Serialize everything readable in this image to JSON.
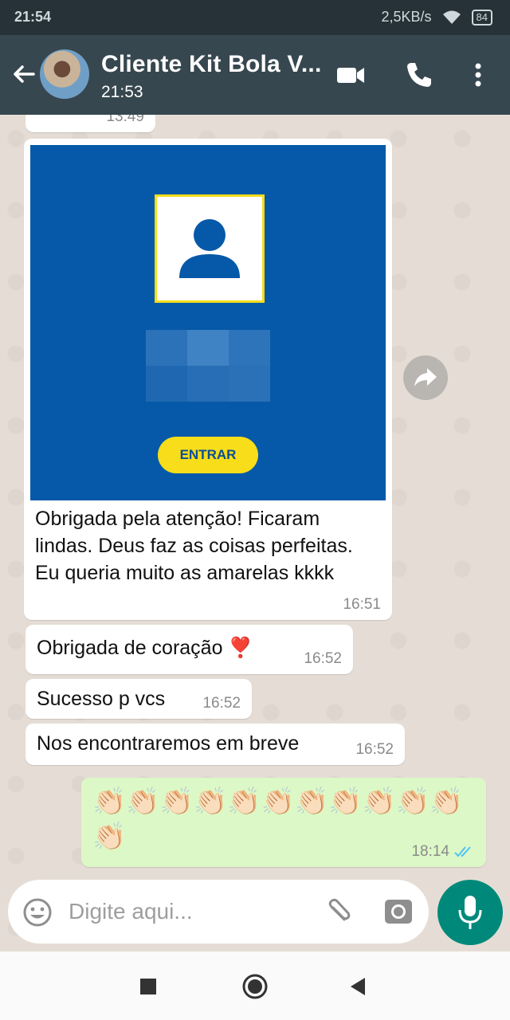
{
  "status_bar": {
    "time": "21:54",
    "network_speed": "2,5KB/s",
    "battery": "84"
  },
  "header": {
    "contact_name": "Cliente Kit Bola V...",
    "last_seen": "21:53"
  },
  "messages": {
    "partial": {
      "time": "13:49"
    },
    "image_message": {
      "button_label": "ENTRAR",
      "text": "Obrigada pela atenção! Ficaram lindas. Deus faz as coisas perfeitas. Eu queria muito as amarelas kkkk",
      "time": "16:51"
    },
    "m2": {
      "text": "Obrigada de coração ❣️",
      "time": "16:52"
    },
    "m3": {
      "text": "Sucesso p vcs",
      "time": "16:52"
    },
    "m4": {
      "text": "Nos encontraremos em breve",
      "time": "16:52"
    },
    "m5": {
      "text": "👏🏻👏🏻👏🏻👏🏻👏🏻👏🏻👏🏻👏🏻👏🏻👏🏻👏🏻👏🏻",
      "time": "18:14"
    }
  },
  "composer": {
    "placeholder": "Digite aqui..."
  },
  "colors": {
    "header": "#37474f",
    "outgoing": "#dcf8c6",
    "accent": "#00897b",
    "image_bg": "#0659a8",
    "button_yellow": "#f7dd1a",
    "read_ticks": "#4fc3f7"
  },
  "icons": [
    "back-arrow-icon",
    "video-call-icon",
    "phone-icon",
    "more-icon",
    "forward-icon",
    "emoji-icon",
    "attach-icon",
    "camera-icon",
    "mic-icon",
    "read-ticks-icon",
    "nav-square-icon",
    "nav-circle-icon",
    "nav-back-icon"
  ]
}
